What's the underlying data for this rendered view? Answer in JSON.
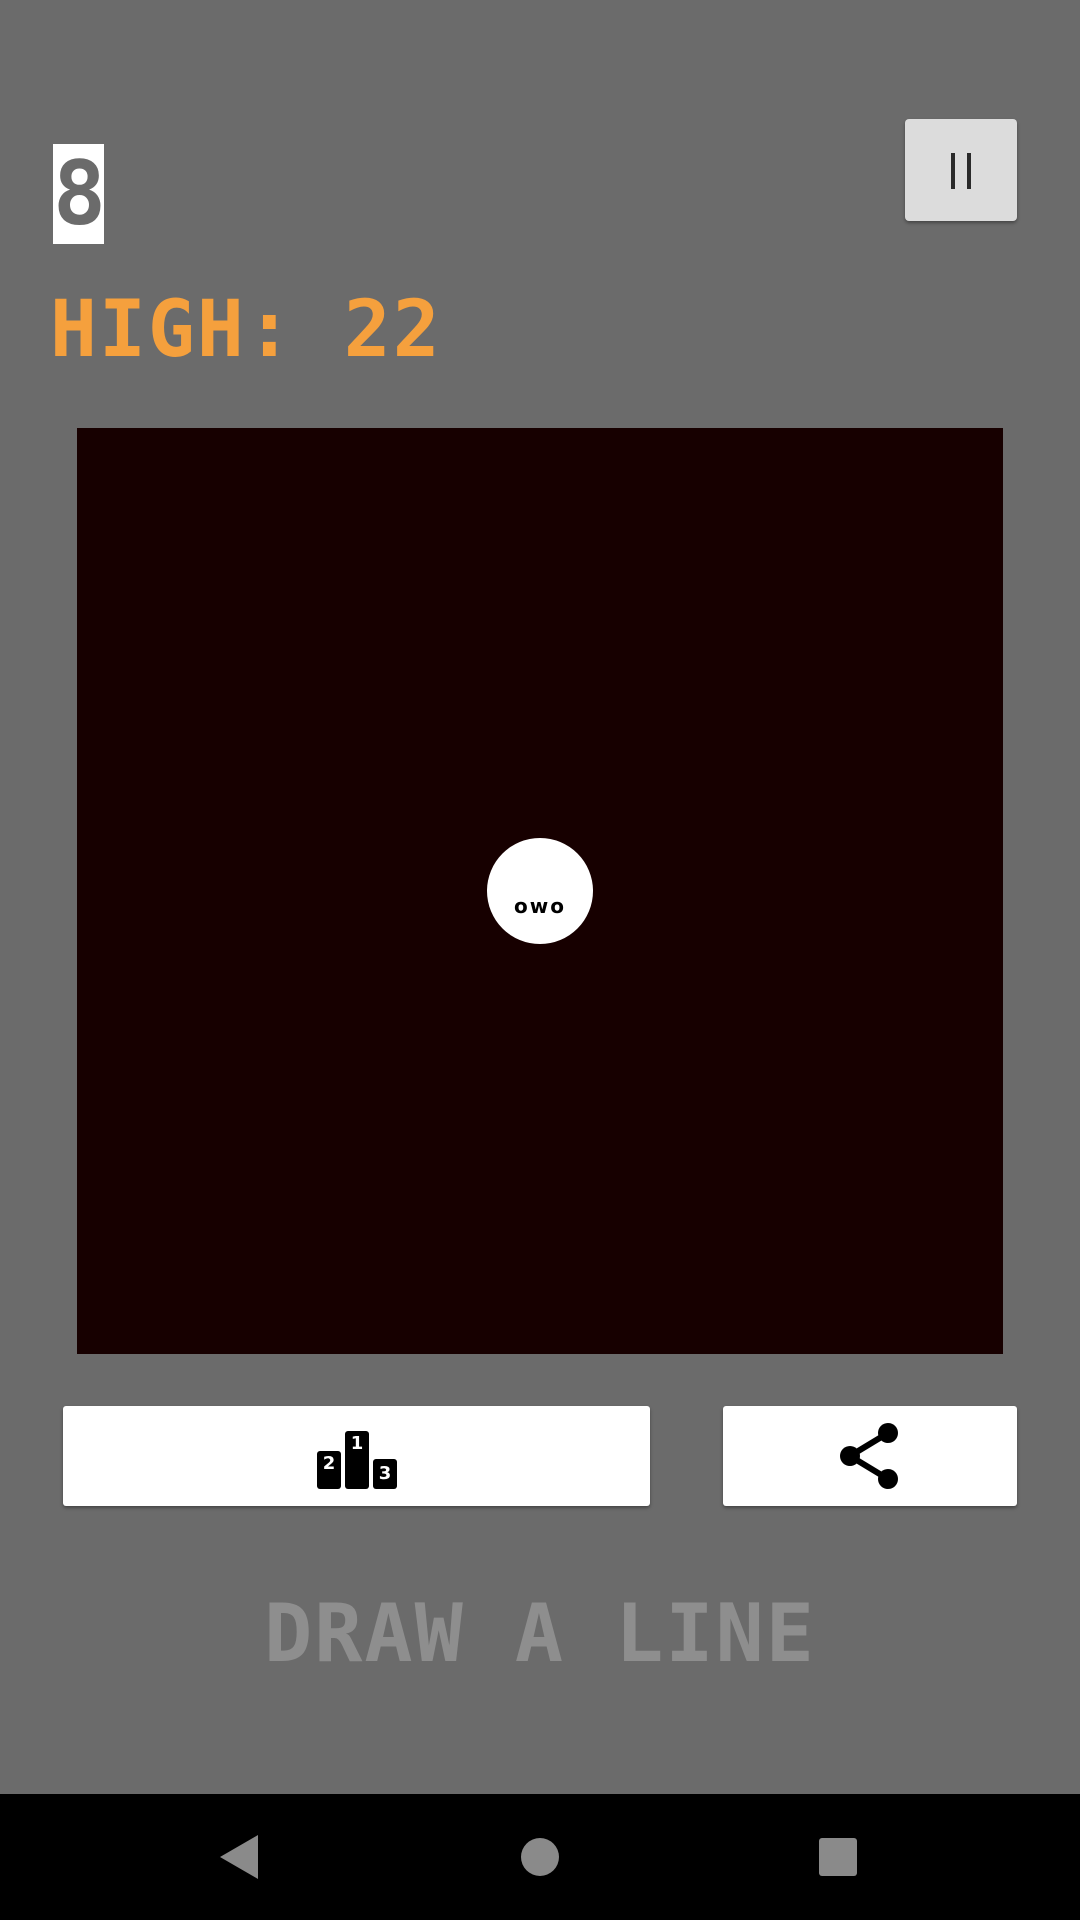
{
  "game": {
    "score": "8",
    "high_score_text": "HIGH: 22",
    "ball_face": "owo",
    "title": "DRAW A LINE"
  },
  "icons": {
    "pause": "pause-icon",
    "leaderboard": "podium-icon",
    "share": "share-icon",
    "back": "triangle-back-icon",
    "home": "circle-home-icon",
    "recents": "square-recents-icon"
  },
  "colors": {
    "background": "#6b6b6b",
    "board": "#170000",
    "high_score": "#f5a03d",
    "title": "#8e8e8e"
  }
}
